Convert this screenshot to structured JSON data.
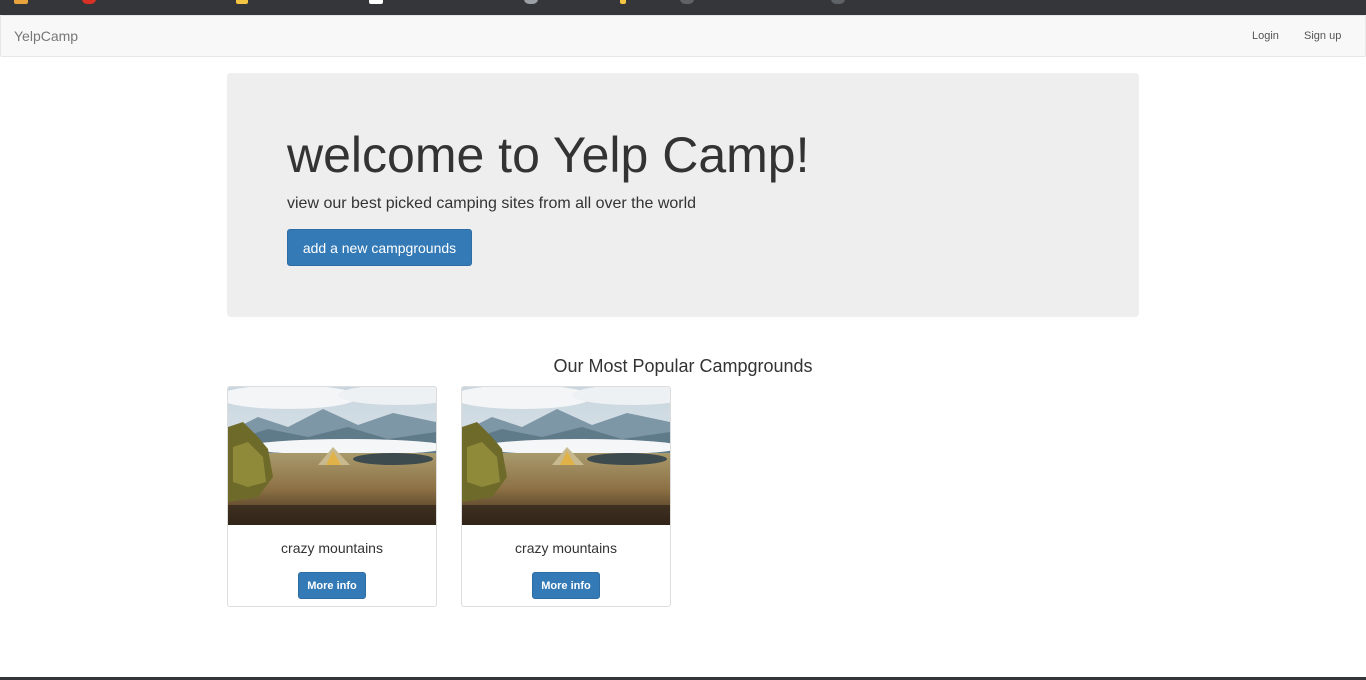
{
  "navbar": {
    "brand": "YelpCamp",
    "login_label": "Login",
    "signup_label": "Sign up"
  },
  "hero": {
    "title": "welcome to Yelp Camp!",
    "subtitle": "view our best picked camping sites from all over the world",
    "button_label": "add a new campgrounds"
  },
  "section": {
    "title": "Our Most Popular Campgrounds"
  },
  "campgrounds": [
    {
      "name": "crazy mountains",
      "button_label": "More info"
    },
    {
      "name": "crazy mountains",
      "button_label": "More info"
    }
  ],
  "colors": {
    "primary": "#337ab7",
    "jumbotron": "#eeeeee",
    "navbar": "#f8f8f8"
  }
}
